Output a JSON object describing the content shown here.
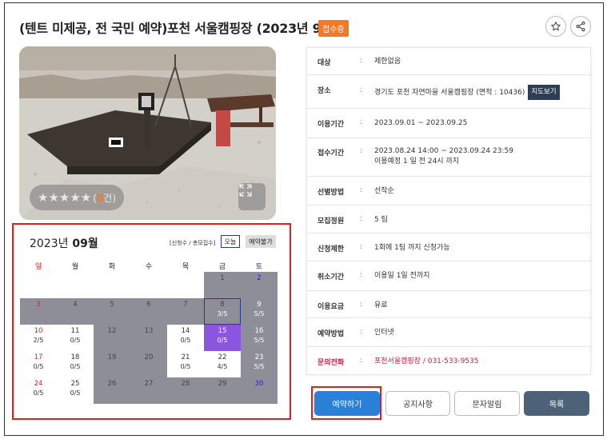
{
  "page": {
    "title": "(텐트 미제공, 전 국민 예약)포천 서울캠핑장 (2023년 9월)",
    "status_badge": "접수중",
    "favorite_icon": "star-icon",
    "share_icon": "share-icon"
  },
  "photo": {
    "stars": "★★★★★",
    "rating_prefix": "(",
    "rating_count": "0",
    "rating_suffix": "건)",
    "expand_icon": "expand-icon"
  },
  "calendar": {
    "year_label": "2023년",
    "month_label": "09월",
    "legend": "[신청수 / 총모집수]",
    "today_button": "오늘",
    "unavailable_button": "예약불가",
    "weekdays": [
      "일",
      "월",
      "화",
      "수",
      "목",
      "금",
      "토"
    ],
    "weeks": [
      [
        {
          "day": "",
          "status": "",
          "state": "white"
        },
        {
          "day": "",
          "status": "",
          "state": "white"
        },
        {
          "day": "",
          "status": "",
          "state": "white"
        },
        {
          "day": "",
          "status": "",
          "state": "white"
        },
        {
          "day": "",
          "status": "",
          "state": "white"
        },
        {
          "day": "1",
          "status": "",
          "state": "gray"
        },
        {
          "day": "2",
          "status": "",
          "state": "gray"
        }
      ],
      [
        {
          "day": "3",
          "status": "",
          "state": "gray"
        },
        {
          "day": "4",
          "status": "",
          "state": "gray"
        },
        {
          "day": "5",
          "status": "",
          "state": "gray"
        },
        {
          "day": "6",
          "status": "",
          "state": "gray"
        },
        {
          "day": "7",
          "status": "",
          "state": "gray"
        },
        {
          "day": "8",
          "status": "3/5",
          "state": "gray-today"
        },
        {
          "day": "9",
          "status": "5/5",
          "state": "gray"
        }
      ],
      [
        {
          "day": "10",
          "status": "2/5",
          "state": "white"
        },
        {
          "day": "11",
          "status": "0/5",
          "state": "white"
        },
        {
          "day": "12",
          "status": "",
          "state": "gray"
        },
        {
          "day": "13",
          "status": "",
          "state": "gray"
        },
        {
          "day": "14",
          "status": "0/5",
          "state": "white"
        },
        {
          "day": "15",
          "status": "0/5",
          "state": "purple"
        },
        {
          "day": "16",
          "status": "5/5",
          "state": "gray"
        }
      ],
      [
        {
          "day": "17",
          "status": "0/5",
          "state": "white"
        },
        {
          "day": "18",
          "status": "0/5",
          "state": "white"
        },
        {
          "day": "19",
          "status": "",
          "state": "gray"
        },
        {
          "day": "20",
          "status": "",
          "state": "gray"
        },
        {
          "day": "21",
          "status": "0/5",
          "state": "white"
        },
        {
          "day": "22",
          "status": "4/5",
          "state": "white"
        },
        {
          "day": "23",
          "status": "5/5",
          "state": "gray"
        }
      ],
      [
        {
          "day": "24",
          "status": "0/5",
          "state": "white"
        },
        {
          "day": "25",
          "status": "0/5",
          "state": "white"
        },
        {
          "day": "26",
          "status": "",
          "state": "gray"
        },
        {
          "day": "27",
          "status": "",
          "state": "gray"
        },
        {
          "day": "28",
          "status": "",
          "state": "gray"
        },
        {
          "day": "29",
          "status": "",
          "state": "gray"
        },
        {
          "day": "30",
          "status": "",
          "state": "gray"
        }
      ]
    ]
  },
  "info": {
    "rows": [
      {
        "label": "대상",
        "value": "제한없음"
      },
      {
        "label": "장소",
        "value": "경기도 포천 자연마을 서울캠핑장 (면적 : 10436)",
        "button": "지도보기"
      },
      {
        "label": "이용기간",
        "value": "2023.09.01 ~ 2023.09.25"
      },
      {
        "label": "접수기간",
        "value": "2023.08.24 14:00 ~ 2023.09.24 23:59",
        "value2": "이용예정 1 일 전 24시 까지"
      },
      {
        "label": "선별방법",
        "value": "선착순"
      },
      {
        "label": "모집정원",
        "value": "5 팀"
      },
      {
        "label": "신청제한",
        "value": "1회에 1팀 까지 신청가능"
      },
      {
        "label": "취소기간",
        "value": "이용일 1일 전까지"
      },
      {
        "label": "이용요금",
        "value": "유료"
      },
      {
        "label": "예약방법",
        "value": "인터넷"
      },
      {
        "label": "문의전화",
        "value": "포천서울캠핑장 / 031-533-9535"
      }
    ],
    "colon": ":"
  },
  "actions": {
    "reserve": "예약하기",
    "notice": "공지사항",
    "sms": "문자알림",
    "list": "목록"
  },
  "colors": {
    "badge": "#f07a2a",
    "primary": "#2a7fd6",
    "available": "#8a55e0",
    "unavailable": "#8e8e98",
    "highlight": "#e02020"
  }
}
